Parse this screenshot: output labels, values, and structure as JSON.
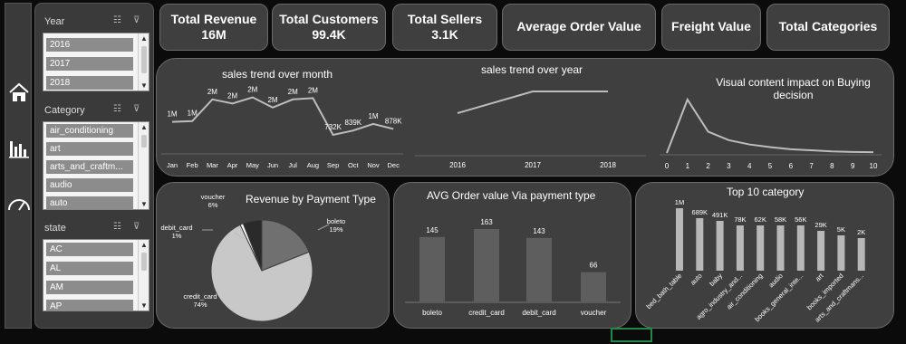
{
  "kpis": [
    {
      "label": "Total Revenue",
      "value": "16M"
    },
    {
      "label": "Total Customers",
      "value": "99.4K"
    },
    {
      "label": "Total Sellers",
      "value": "3.1K"
    },
    {
      "label": "Average Order Value",
      "value": ""
    },
    {
      "label": "Freight Value",
      "value": ""
    },
    {
      "label": "Total Categories",
      "value": ""
    }
  ],
  "slicers": {
    "year": {
      "title": "Year",
      "items": [
        "2016",
        "2017",
        "2018"
      ]
    },
    "category": {
      "title": "Category",
      "items": [
        "air_conditioning",
        "art",
        "arts_and_craftm...",
        "audio",
        "auto"
      ]
    },
    "state": {
      "title": "state",
      "items": [
        "AC",
        "AL",
        "AM",
        "AP"
      ]
    }
  },
  "icons": [
    "home-icon",
    "bar-chart-icon",
    "gauge-icon",
    "multi-select-icon",
    "clear-filter-icon"
  ],
  "chart_data": [
    {
      "type": "line",
      "title": "sales trend over month",
      "categories": [
        "Jan",
        "Feb",
        "Mar",
        "Apr",
        "May",
        "Jun",
        "Jul",
        "Aug",
        "Sep",
        "Oct",
        "Nov",
        "Dec"
      ],
      "values": [
        1.05,
        1.07,
        1.6,
        1.5,
        1.65,
        1.4,
        1.6,
        1.63,
        0.732,
        0.839,
        1.0,
        0.878
      ],
      "labels": [
        "1M",
        "1M",
        "2M",
        "2M",
        "2M",
        "2M",
        "2M",
        "2M",
        "732K",
        "839K",
        "1M",
        "878K"
      ]
    },
    {
      "type": "line",
      "title": "sales trend over year",
      "categories": [
        "2016",
        "2017",
        "2018"
      ],
      "values": [
        0.5,
        0.9,
        0.9
      ]
    },
    {
      "type": "line",
      "title": "Visual content impact on Buying decision",
      "categories": [
        "0",
        "1",
        "2",
        "3",
        "4",
        "5",
        "6",
        "7",
        "8",
        "9",
        "10"
      ],
      "values": [
        0,
        100,
        40,
        24,
        16,
        11,
        7,
        5,
        3,
        2,
        1.5
      ]
    },
    {
      "type": "pie",
      "title": "Revenue by Payment Type",
      "slices": [
        {
          "name": "boleto",
          "pct": 19,
          "label": "19%",
          "color": "#707070"
        },
        {
          "name": "credit_card",
          "pct": 74,
          "label": "74%",
          "color": "#c8c8c8"
        },
        {
          "name": "debit_card",
          "pct": 1,
          "label": "1%",
          "color": "#ffffff"
        },
        {
          "name": "voucher",
          "pct": 6,
          "label": "6%",
          "color": "#2a2a2a"
        }
      ]
    },
    {
      "type": "bar",
      "title": "AVG Order value Via payment type",
      "categories": [
        "boleto",
        "credit_card",
        "debit_card",
        "voucher"
      ],
      "values": [
        145,
        163,
        143,
        66
      ]
    },
    {
      "type": "bar",
      "title": "Top 10 category",
      "categories": [
        "bed_bath_table",
        "auto",
        "baby",
        "agro_industry_and...",
        "air_conditioning",
        "audio",
        "books_general_inte...",
        "art",
        "books_imported",
        "arts_and_craftmans..."
      ],
      "values": [
        1000,
        689,
        491,
        78,
        62,
        58,
        56,
        29,
        5,
        2
      ],
      "labels": [
        "1M",
        "689K",
        "491K",
        "78K",
        "62K",
        "58K",
        "56K",
        "29K",
        "5K",
        "2K"
      ]
    }
  ]
}
